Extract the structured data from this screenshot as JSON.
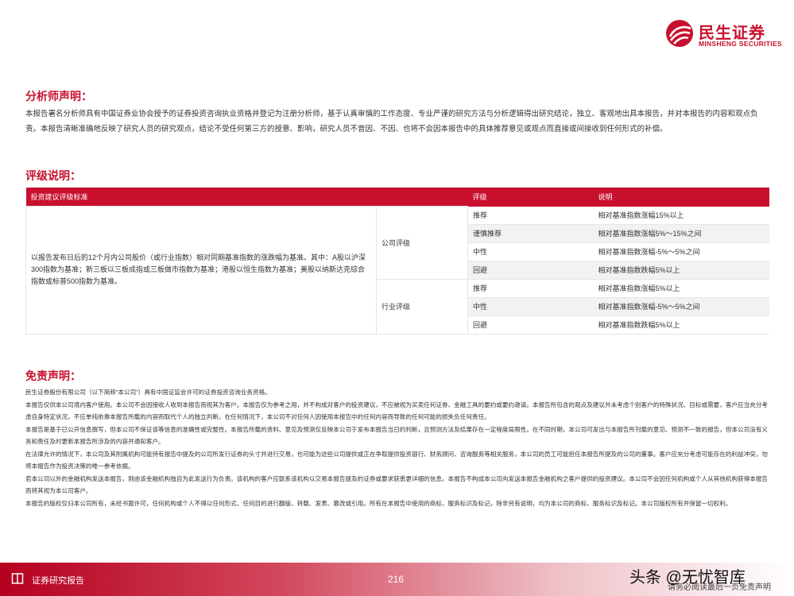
{
  "brand": {
    "name_cn": "民生证券",
    "name_en": "MINSHENG SECURITIES",
    "color": "#c8102e"
  },
  "analyst": {
    "title": "分析师声明：",
    "text": "本报告署名分析师具有中国证券业协会授予的证券投资咨询执业资格并登记为注册分析师，基于认真审慎的工作态度、专业严谨的研究方法与分析逻辑得出研究结论，独立、客观地出具本报告，并对本报告的内容和观点负责。本报告清晰准确地反映了研究人员的研究观点，结论不受任何第三方的授意、影响，研究人员不曾因、不因、也将不会因本报告中的具体推荐意见或观点而直接或间接收到任何形式的补偿。"
  },
  "rating": {
    "title": "评级说明：",
    "headers": [
      "投资建议评级标准",
      "评级",
      "说明"
    ],
    "standard": "以报告发布日后的12个月内公司股价（或行业指数）相对同期基准指数的涨跌幅为基准。其中：A股以沪深300指数为基准；新三板以三板成指或三板做市指数为基准；港股以恒生指数为基准；美股以纳斯达克综合指数或标普500指数为基准。",
    "company": {
      "label": "公司评级",
      "rows": [
        {
          "level": "推荐",
          "desc": "相对基准指数涨幅15%以上"
        },
        {
          "level": "谨慎推荐",
          "desc": "相对基准指数涨幅5%～15%之间"
        },
        {
          "level": "中性",
          "desc": "相对基准指数涨幅-5%～5%之间"
        },
        {
          "level": "回避",
          "desc": "相对基准指数跌幅5%以上"
        }
      ]
    },
    "industry": {
      "label": "行业评级",
      "rows": [
        {
          "level": "推荐",
          "desc": "相对基准指数涨幅5%以上"
        },
        {
          "level": "中性",
          "desc": "相对基准指数涨幅-5%～5%之间"
        },
        {
          "level": "回避",
          "desc": "相对基准指数跌幅5%以上"
        }
      ]
    }
  },
  "disclaimer": {
    "title": "免责声明：",
    "paragraphs": [
      "民生证券股份有限公司（以下简称“本公司”）具有中国证监会许可的证券投资咨询业务资格。",
      "本报告仅供本公司境内客户使用。本公司不会因接收人收到本报告而视其为客户。本报告仅为参考之用，并不构成对客户的投资建议，不应被视为买卖任何证券、金融工具的要约或要约邀请。本报告所包含的观点及建议并未考虑个别客户的特殊状况、目标或需要，客户应当充分考虑自身特定状况，不应单纯依靠本报告所载的内容而取代个人的独立判断。在任何情况下，本公司不对任何人因使用本报告中的任何内容而导致的任何可能的损失负任何责任。",
      "本报告是基于已公开信息撰写，但本公司不保证该等信息的准确性或完整性。本报告所载的资料、意见及预测仅反映本公司于发布本报告当日的判断，且预测方法及结果存在一定程度局限性。在不同时期，本公司可发出与本报告所刊载的意见、预测不一致的报告，但本公司没有义务和责任及时更新本报告所涉及的内容并通知客户。",
      "在法律允许的情况下，本公司及其附属机构可能持有报告中提及的公司所发行证券的头寸并进行交易，也可能为这些公司提供或正在争取提供投资银行、财务顾问、咨询服务等相关服务，本公司的员工可能担任本报告所提及的公司的董事。客户应充分考虑可能存在的利益冲突，勿将本报告作为投资决策的唯一参考依据。",
      "若本公司以外的金融机构发送本报告，则由该金融机构独自为此发送行为负责。该机构的客户应联系该机构以交易本报告提及的证券或要求获悉更详细的信息。本报告不构成本公司向发送本报告金融机构之客户提供的投资建议。本公司不会因任何机构或个人从其他机构获得本报告而将其视为本公司客户。",
      "本报告的版权仅归本公司所有，未经书面许可，任何机构或个人不得以任何形式、任何目的进行翻版、转载、发表、篡改或引用。所有在本报告中使用的商标、服务标识及标记，除非另有说明，均为本公司的商标、服务标识及标记。本公司版权所有并保留一切权利。"
    ]
  },
  "footer": {
    "label": "证券研究报告",
    "page_number": "216",
    "note": "请务必阅读最后一页免责声明",
    "watermark": "头条 @无忧智库"
  }
}
